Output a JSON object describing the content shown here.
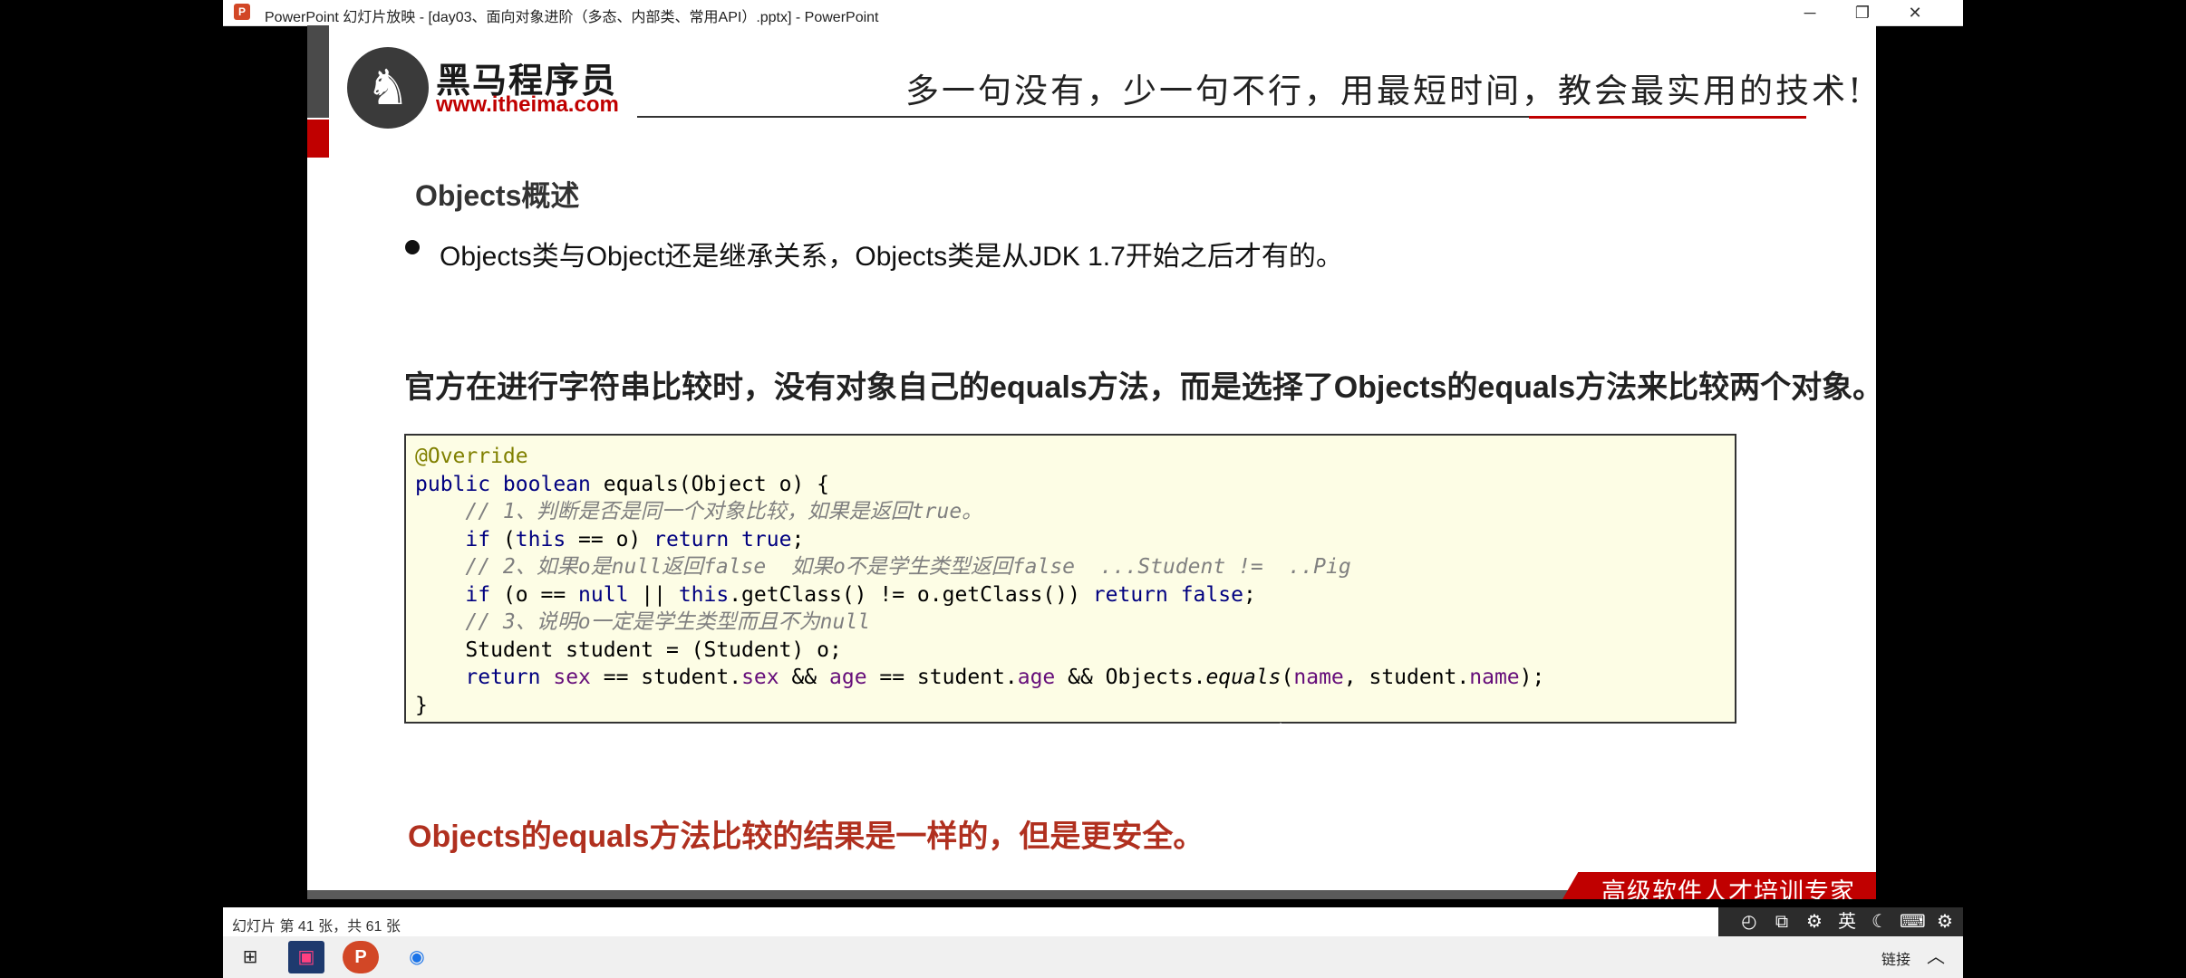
{
  "window": {
    "app_icon_glyph": "P",
    "title": "PowerPoint 幻灯片放映 - [day03、面向对象进阶（多态、内部类、常用API）.pptx] - PowerPoint",
    "minimize_glyph": "─",
    "restore_glyph": "❐",
    "close_glyph": "✕"
  },
  "slide": {
    "logo_cn": "黑马程序员",
    "logo_url": "www.itheima.com",
    "slogan": "多一句没有，少一句不行，用最短时间，教会最实用的技术!",
    "section_title": "Objects概述",
    "bullet": "Objects类与Object还是继承关系，Objects类是从JDK 1.7开始之后才有的。",
    "statement": "官方在进行字符串比较时，没有对象自己的equals方法，而是选择了Objects的equals方法来比较两个对象。",
    "code": {
      "l1": "@Override",
      "l2_kw": "public boolean",
      "l2_rest": " equals(Object o) {",
      "l3": "    // 1、判断是否是同一个对象比较，如果是返回true。",
      "l4_indent": "    ",
      "l4_kw1": "if",
      "l4_mid1": " (",
      "l4_kw2": "this",
      "l4_mid2": " == o) ",
      "l4_kw3": "return true",
      "l4_end": ";",
      "l5": "    // 2、如果o是null返回false  如果o不是学生类型返回false  ...Student !=  ..Pig",
      "l6_indent": "    ",
      "l6_kw1": "if",
      "l6_mid1": " (o == ",
      "l6_kw2": "null",
      "l6_mid2": " || ",
      "l6_kw3": "this",
      "l6_mid3": ".getClass() != o.getClass()) ",
      "l6_kw4": "return false",
      "l6_end": ";",
      "l7": "    // 3、说明o一定是学生类型而且不为null",
      "l8": "    Student student = (Student) o;",
      "l9_indent": "    ",
      "l9_kw": "return",
      "l9_sp": " ",
      "l9_f1": "sex",
      "l9_t1": " == student.",
      "l9_f2": "sex",
      "l9_t2": " && ",
      "l9_f3": "age",
      "l9_t3": " == student.",
      "l9_f4": "age",
      "l9_t4": " && Objects.",
      "l9_m": "equals",
      "l9_t5": "(",
      "l9_f5": "name",
      "l9_t6": ", student.",
      "l9_f6": "name",
      "l9_t7": ");",
      "l10": "}"
    },
    "conclusion": "Objects的equals方法比较的结果是一样的，但是更安全。",
    "footer_badge": "高级软件人才培训专家"
  },
  "statusbar": {
    "slide_info": "幻灯片 第 41 张，共 61 张",
    "icons": [
      "◴",
      "⧉",
      "⚙",
      "英",
      "☾",
      "⌨",
      "⚙"
    ]
  },
  "taskbar": {
    "start_glyph": "⊞",
    "app1_glyph": "▣",
    "app2_glyph": "P",
    "app3_glyph": "◉",
    "tray_text": "链接",
    "tray_arrow": "︿"
  },
  "colors": {
    "brand_red": "#c00000",
    "code_bg": "#fdfde5",
    "keyword": "#000080",
    "comment": "#808080",
    "field": "#660e7a",
    "annotation": "#808000",
    "conclusion": "#b0301f"
  }
}
